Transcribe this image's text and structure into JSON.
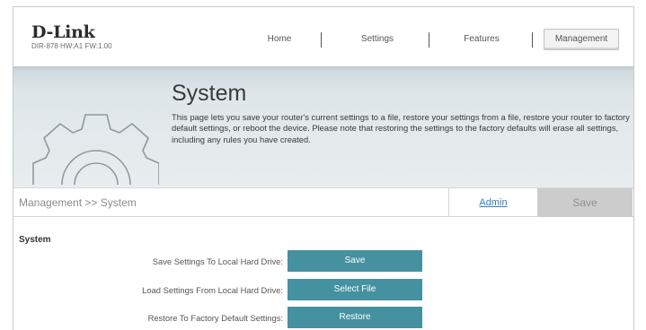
{
  "header": {
    "brand": "D-Link",
    "device_info": "DIR-878 HW:A1 FW:1.00",
    "nav": [
      {
        "label": "Home"
      },
      {
        "label": "Settings"
      },
      {
        "label": "Features"
      },
      {
        "label": "Management"
      }
    ],
    "active_nav": "Management"
  },
  "banner": {
    "title": "System",
    "description": "This page lets you save your router's current settings to a file, restore your settings from a file, restore your router to factory default settings, or reboot the device. Please note that restoring the settings to the factory defaults will erase all settings, including any rules you have created.",
    "icon": "gear-icon"
  },
  "breadcrumb": {
    "path": "Management >> System",
    "admin_link": "Admin",
    "save_label": "Save"
  },
  "section": {
    "title": "System",
    "rows": [
      {
        "label": "Save Settings To Local Hard Drive:",
        "button": "Save"
      },
      {
        "label": "Load Settings From Local Hard Drive:",
        "button": "Select File"
      },
      {
        "label": "Restore To Factory Default Settings:",
        "button": "Restore"
      }
    ]
  },
  "colors": {
    "accent_button": "#4591a0",
    "link": "#2f7ec1",
    "save_disabled": "#cccccc"
  }
}
